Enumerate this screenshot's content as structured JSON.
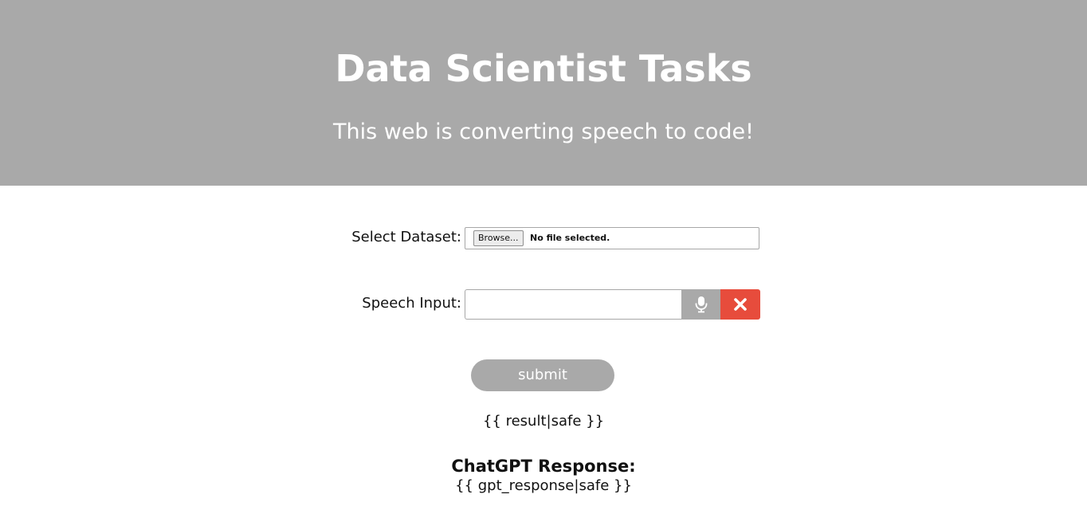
{
  "header": {
    "title": "Data Scientist Tasks",
    "subtitle": "This web is converting speech to code!",
    "background_color": "#a9a9a9"
  },
  "form": {
    "dataset_label": "Select Dataset:",
    "browse_label": "Browse...",
    "file_status": "No file selected.",
    "speech_label": "Speech Input:",
    "speech_value": "",
    "mic_icon": "microphone-icon",
    "clear_icon": "close-icon",
    "clear_color": "#e74c3c",
    "submit_label": "submit"
  },
  "output": {
    "result": "{{ result|safe }}",
    "gpt_heading": "ChatGPT Response:",
    "gpt_response": "{{ gpt_response|safe }}"
  }
}
